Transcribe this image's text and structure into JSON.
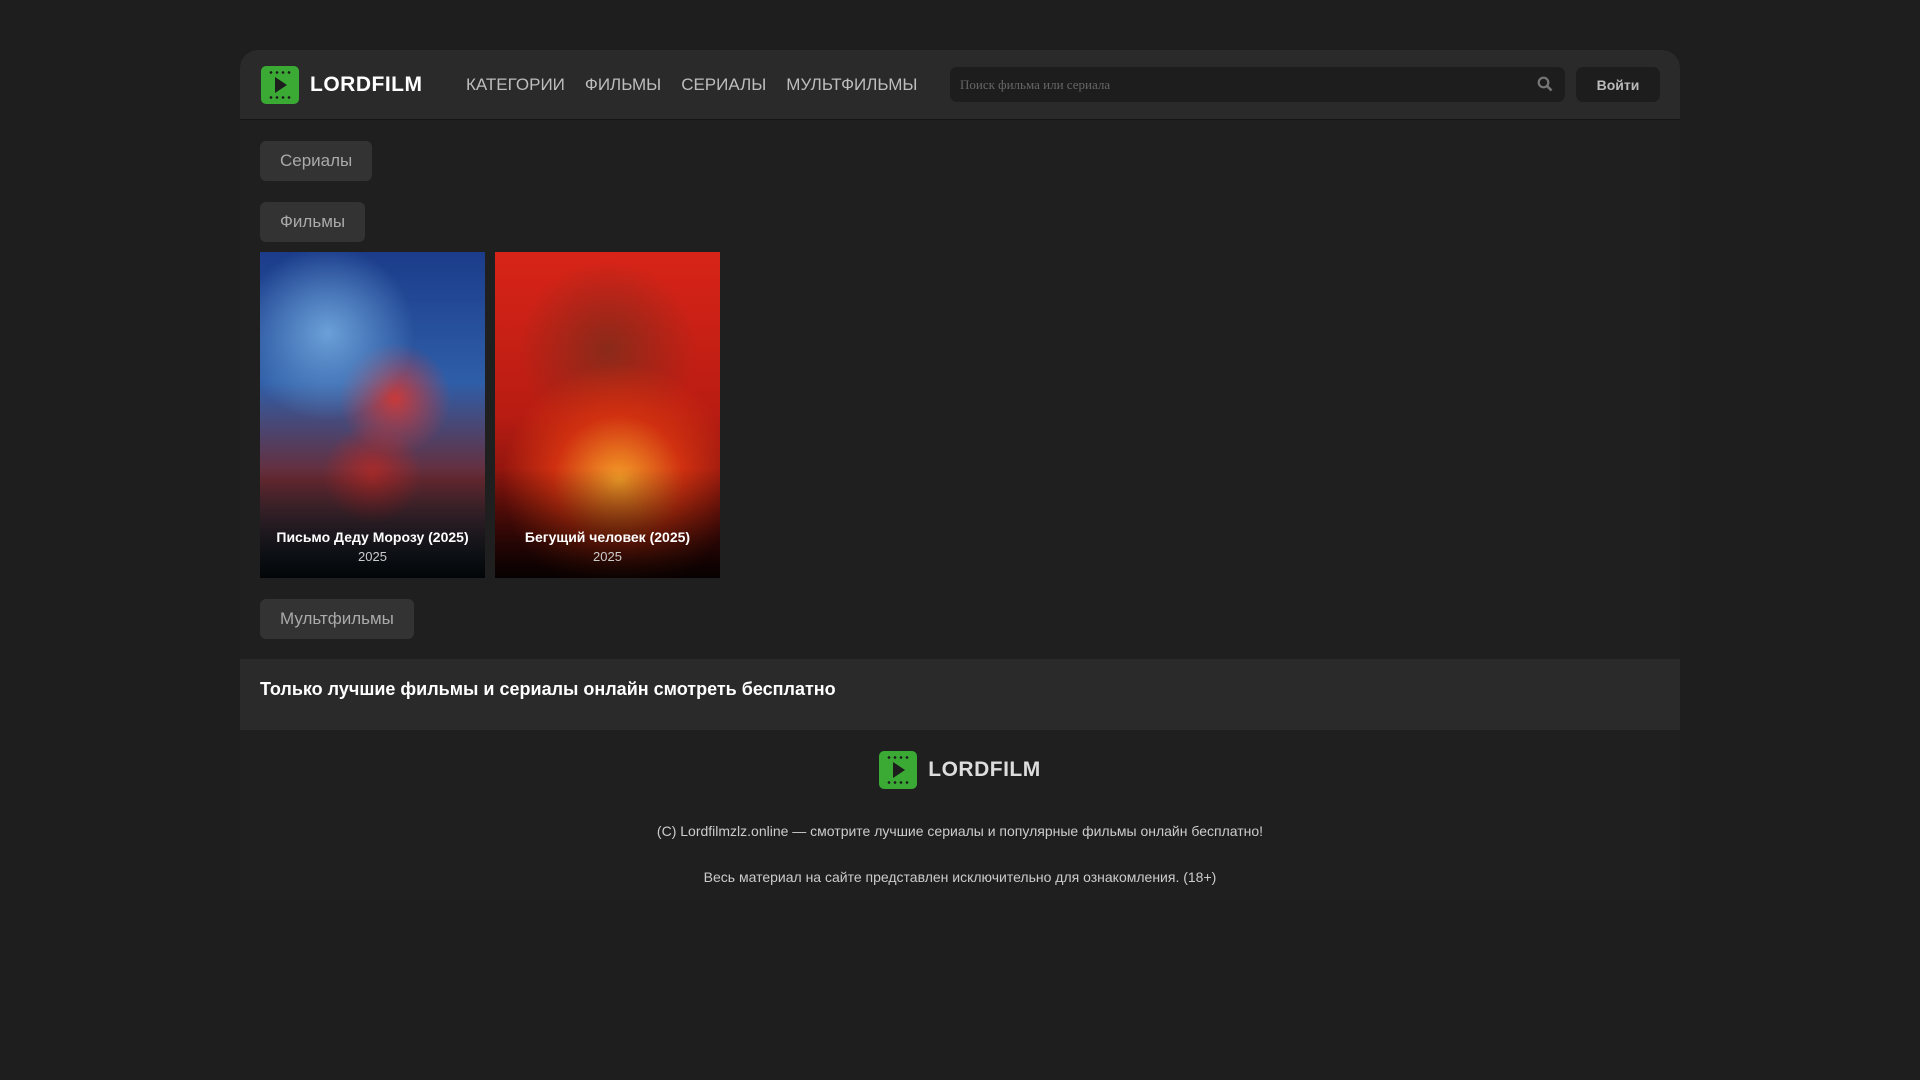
{
  "header": {
    "logo": "LORDFILM",
    "nav": [
      "КАТЕГОРИИ",
      "ФИЛЬМЫ",
      "СЕРИАЛЫ",
      "МУЛЬТФИЛЬМЫ"
    ],
    "search_placeholder": "Поиск фильма или сериала",
    "search_icon": "search-icon",
    "login": "Войти"
  },
  "sections": {
    "serials": "Сериалы",
    "films": "Фильмы",
    "cartoons": "Мультфильмы"
  },
  "films": [
    {
      "title": "Письмо Деду Морозу (2025)",
      "year": "2025"
    },
    {
      "title": "Бегущий человек (2025)",
      "year": "2025"
    }
  ],
  "tagline": "Только лучшие фильмы и сериалы онлайн смотреть бесплатно",
  "footer": {
    "logo": "LORDFILM",
    "copyright": "(C) Lordfilmzlz.online — смотрите лучшие сериалы и популярные фильмы онлайн бесплатно!",
    "disclaimer": "Весь материал на сайте представлен исключительно для ознакомления. (18+)"
  },
  "colors": {
    "accent": "#3aaa35",
    "background": "#1e1e1e",
    "header": "#2a2a2a"
  }
}
